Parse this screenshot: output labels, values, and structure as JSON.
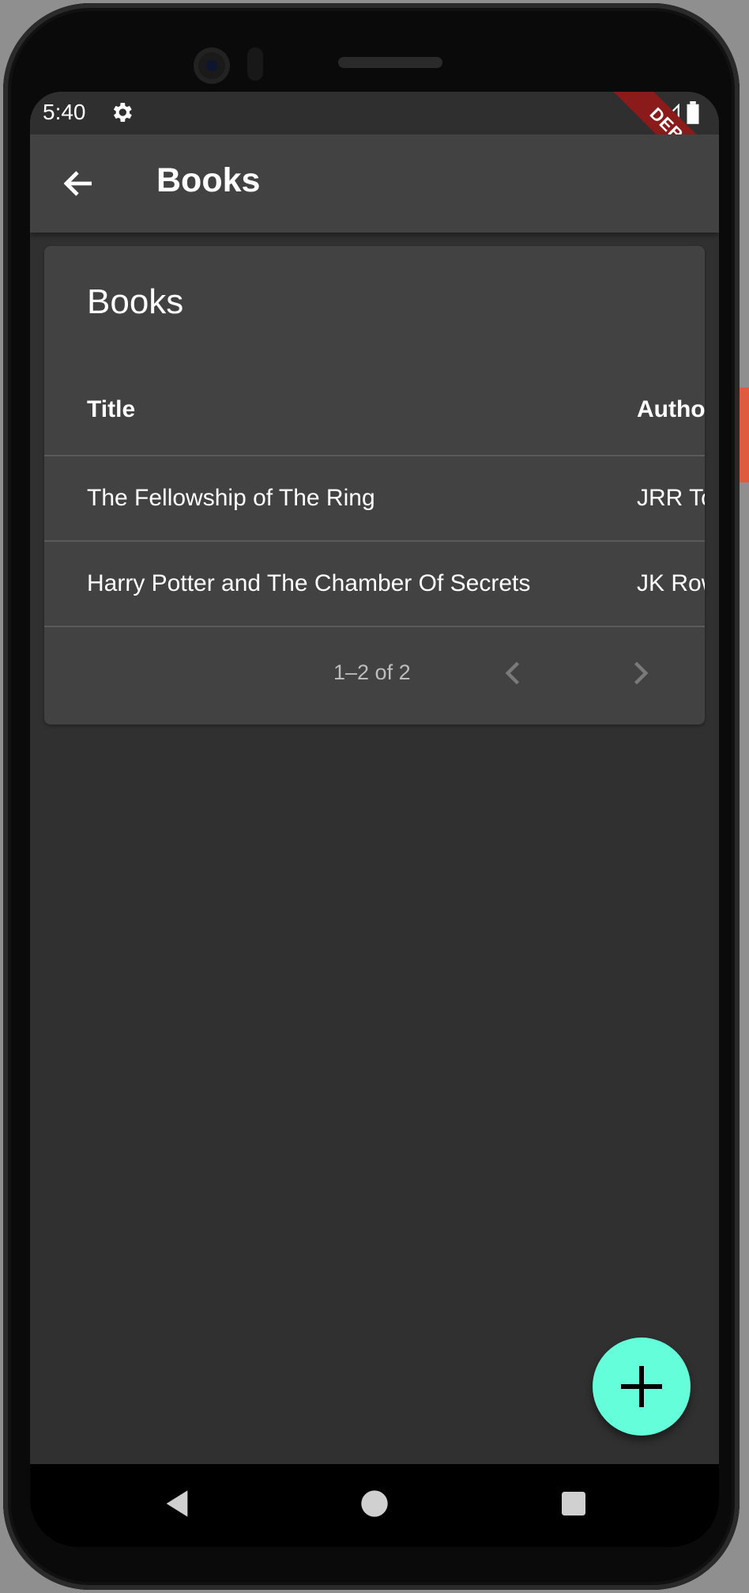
{
  "status_bar": {
    "time": "5:40",
    "debug_banner": "DEBUG"
  },
  "app_bar": {
    "title": "Books"
  },
  "card": {
    "title": "Books",
    "columns": [
      "Title",
      "Author"
    ],
    "rows": [
      {
        "title": "The Fellowship of The Ring",
        "author": "JRR Tolkien"
      },
      {
        "title": "Harry Potter and The Chamber Of Secrets",
        "author": "JK Rowling"
      }
    ],
    "pagination": {
      "label": "1–2 of 2"
    }
  },
  "colors": {
    "fab": "#64ffda",
    "background": "#303030",
    "card": "#424242",
    "appbar": "#424242"
  },
  "icons": [
    "gear-icon",
    "wifi-icon",
    "signal-icon",
    "battery-icon",
    "back-arrow-icon",
    "chevron-left-icon",
    "chevron-right-icon",
    "add-icon",
    "nav-back-icon",
    "nav-home-icon",
    "nav-recents-icon"
  ]
}
